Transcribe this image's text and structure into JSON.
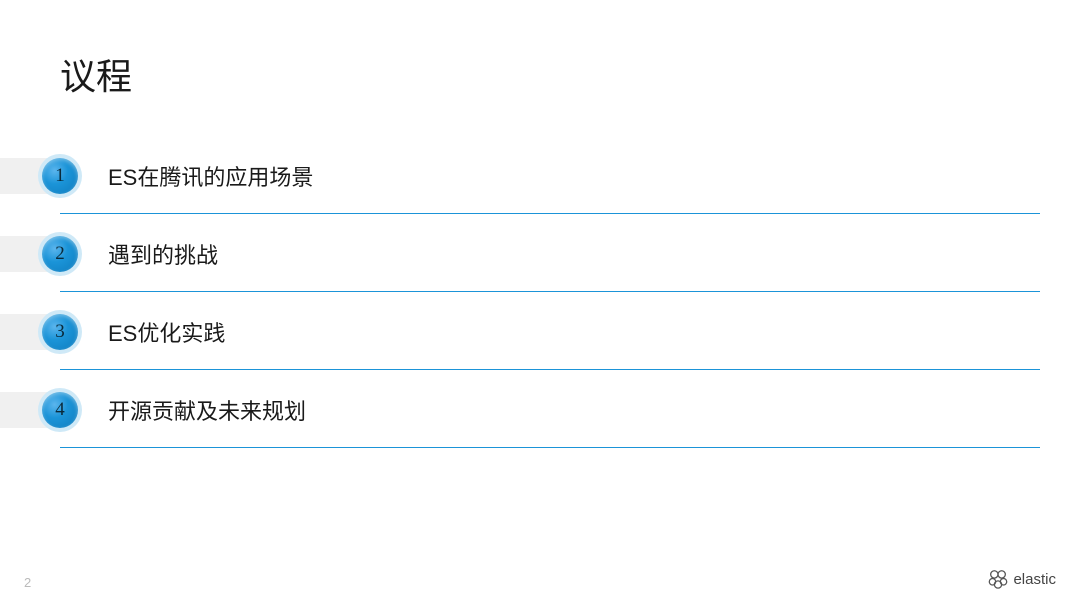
{
  "title": "议程",
  "agenda": [
    {
      "num": "1",
      "text": "ES在腾讯的应用场景"
    },
    {
      "num": "2",
      "text": "遇到的挑战"
    },
    {
      "num": "3",
      "text": "ES优化实践"
    },
    {
      "num": "4",
      "text": "开源贡献及未来规划"
    }
  ],
  "pageNumber": "2",
  "brand": "elastic"
}
